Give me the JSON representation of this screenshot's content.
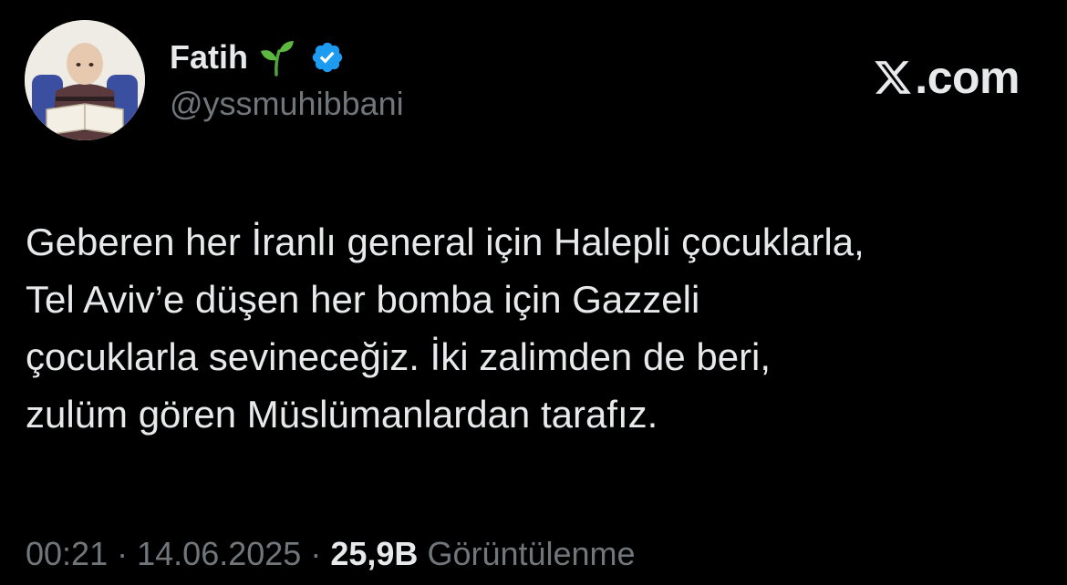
{
  "author": {
    "display_name": "Fatih",
    "handle": "@yssmuhibbani",
    "name_emoji_icon": "seedling-icon",
    "verified_icon": "verified-badge-icon",
    "verified_color": "#1d9bf0"
  },
  "brand": {
    "logo_icon": "x-logo-icon",
    "suffix": ".com"
  },
  "tweet": {
    "lines": [
      "Geberen her İranlı general için Halepli çocuklarla,",
      "Tel Aviv’e düşen her bomba için Gazzeli",
      "çocuklarla sevineceğiz. İki zalimden de beri,",
      "zulüm gören Müslümanlardan tarafız."
    ]
  },
  "meta": {
    "time": "00:21",
    "separator": "·",
    "date": "14.06.2025",
    "views_count": "25,9B",
    "views_label": "Görüntülenme"
  },
  "colors": {
    "background": "#000000",
    "primary_text": "#e7e9ea",
    "secondary_text": "#71767b"
  }
}
